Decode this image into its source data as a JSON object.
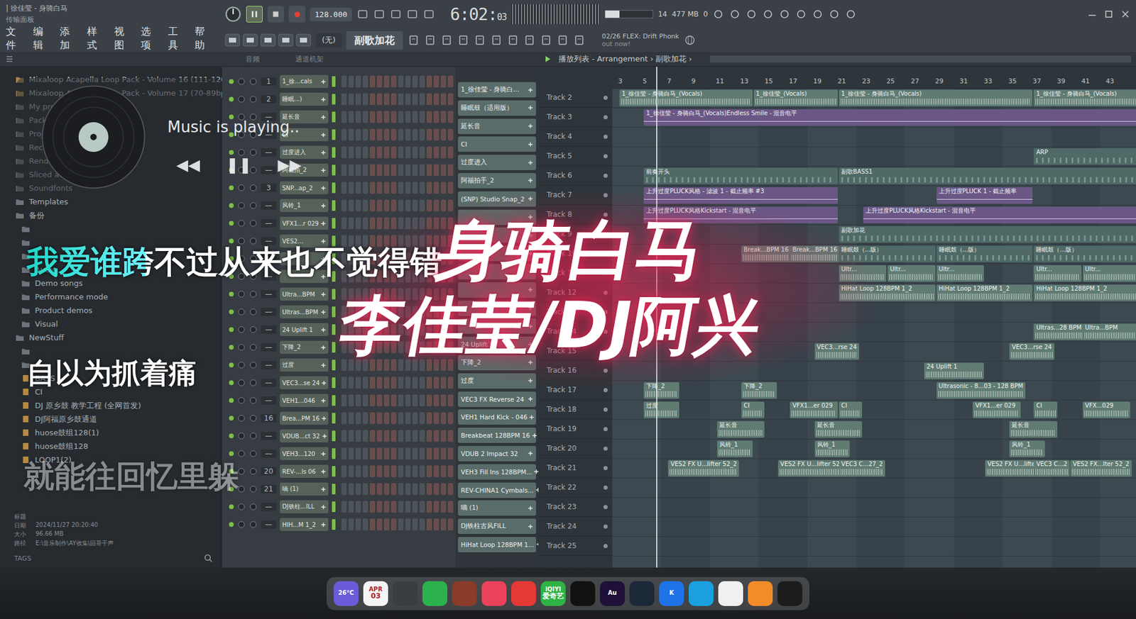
{
  "window": {
    "title": "| 徐佳莹 - 身骑白马",
    "subtitle": "传输面板"
  },
  "menu": [
    "文件",
    "编辑",
    "添加",
    "样式",
    "视图",
    "选项",
    "工具",
    "帮助"
  ],
  "transport": {
    "playing": true,
    "tempo": "128.000",
    "time": "6:02:",
    "time_frac": "03",
    "cpu": "14",
    "memory": "477 MB",
    "poly": "0",
    "snap": "(无)",
    "pattern": "副歌加花",
    "hint_title": "02/26 FLEX: Drift Phonk",
    "hint_body": "out now!"
  },
  "browser": {
    "items": [
      {
        "label": "Mixaloop Acapella Loop Pack - Volume 16 (111-120bpm)",
        "kind": "pack",
        "depth": 0
      },
      {
        "label": "Mixaloop Acapella Loop Pack - Volume 17 (70-89bpm)",
        "kind": "pack",
        "depth": 0
      },
      {
        "label": "My projects",
        "kind": "folder",
        "depth": 0
      },
      {
        "label": "Pack",
        "kind": "folder",
        "depth": 0
      },
      {
        "label": "Proj",
        "kind": "folder",
        "depth": 0
      },
      {
        "label": "Recor",
        "kind": "folder",
        "depth": 0
      },
      {
        "label": "Rendered",
        "kind": "folder",
        "depth": 0
      },
      {
        "label": "Sliced audio",
        "kind": "folder",
        "depth": 0
      },
      {
        "label": "Soundfonts",
        "kind": "folder",
        "depth": 0
      },
      {
        "label": "Templates",
        "kind": "folder",
        "depth": 0
      },
      {
        "label": "备份",
        "kind": "folder",
        "depth": 0
      },
      {
        "label": "",
        "kind": "folder",
        "depth": 1
      },
      {
        "label": "",
        "kind": "folder",
        "depth": 1
      },
      {
        "label": "",
        "kind": "folder",
        "depth": 1
      },
      {
        "label": "Audio",
        "kind": "folder",
        "depth": 1
      },
      {
        "label": "Demo songs",
        "kind": "folder",
        "depth": 1
      },
      {
        "label": "Performance mode",
        "kind": "folder",
        "depth": 1
      },
      {
        "label": "Product demos",
        "kind": "folder",
        "depth": 1
      },
      {
        "label": "Visual",
        "kind": "folder",
        "depth": 1
      },
      {
        "label": "NewStuff",
        "kind": "folder",
        "depth": 0
      },
      {
        "label": "",
        "kind": "folder",
        "depth": 1
      },
      {
        "label": "",
        "kind": "folder",
        "depth": 1
      },
      {
        "label": "BASS",
        "kind": "project",
        "depth": 1
      },
      {
        "label": "CI",
        "kind": "project",
        "depth": 1
      },
      {
        "label": "DJ 原乡鼓 教学工程 (全网首发)",
        "kind": "project",
        "depth": 1
      },
      {
        "label": "DJ阿福原乡鼓通道",
        "kind": "project",
        "depth": 1
      },
      {
        "label": "huose鼓组128(1)",
        "kind": "project",
        "depth": 1
      },
      {
        "label": "huose鼓组128",
        "kind": "project",
        "depth": 1
      },
      {
        "label": "LOOP1(2)",
        "kind": "project",
        "depth": 1
      }
    ],
    "file_info": [
      {
        "key": "标题",
        "value": ""
      },
      {
        "key": "日期",
        "value": "2024/11/27 20:20:40"
      },
      {
        "key": "大小",
        "value": "96.66 MB"
      },
      {
        "key": "路径",
        "value": "E:\\音乐制作\\AY收集\\回哥干声"
      }
    ],
    "tags": "TAGS"
  },
  "channel_rack": {
    "filter": "音频",
    "title": "通道机架",
    "rows": [
      {
        "num": "1",
        "name": "1_徐...cals"
      },
      {
        "num": "2",
        "name": "睡眠...)"
      },
      {
        "num": "—",
        "name": "延长音"
      },
      {
        "num": "—",
        "name": "CI"
      },
      {
        "num": "—",
        "name": "过度进入"
      },
      {
        "num": "—",
        "name": "阿福拍_2"
      },
      {
        "num": "3",
        "name": "SNP...ap_2"
      },
      {
        "num": "—",
        "name": "风铃_1"
      },
      {
        "num": "—",
        "name": "VFX1...r 029"
      },
      {
        "num": "—",
        "name": "VES2..."
      },
      {
        "num": "—",
        "name": ""
      },
      {
        "num": "—",
        "name": ""
      },
      {
        "num": "—",
        "name": "Ultra...BPM"
      },
      {
        "num": "—",
        "name": "Ultras...BPM"
      },
      {
        "num": "—",
        "name": "24 Uplift 1"
      },
      {
        "num": "—",
        "name": "下降_2"
      },
      {
        "num": "—",
        "name": "过度"
      },
      {
        "num": "—",
        "name": "VEC3...se 24"
      },
      {
        "num": "—",
        "name": "VEH1...046"
      },
      {
        "num": "16",
        "name": "Brea...PM 16"
      },
      {
        "num": "—",
        "name": "VDUB...ct 32"
      },
      {
        "num": "—",
        "name": "VEH3...120"
      },
      {
        "num": "20",
        "name": "REV-...ls 06"
      },
      {
        "num": "21",
        "name": "嘀 (1)"
      },
      {
        "num": "—",
        "name": "DJ铁柱...ILL"
      },
      {
        "num": "—",
        "name": "HIH...M 1_2"
      }
    ]
  },
  "patterns": [
    "1_徐佳莹 - 身骑白...",
    "睡眠鼓（适用版）",
    "延长音",
    "CI",
    "过度进入",
    "阿福拍手_2",
    "(SNP) Studio Snap_2",
    "",
    "",
    "",
    "",
    "",
    "",
    "",
    "24 Uplift 1",
    "下降_2",
    "过度",
    "VEC3 FX Reverse 24",
    "VEH1 Hard Kick - 046",
    "Breakbeat 128BPM 16",
    "VDUB 2 Impact 32",
    "VEH3 Fill Ins 128BPM...",
    "REV-CHINA1 Cymbals...",
    "嘀 (1)",
    "DJ铁柱古风FILL",
    "HiHat Loop 128BPM 1..."
  ],
  "playlist": {
    "breadcrumb": "播放列表 - Arrangement › 副歌加花 ›",
    "playhead": 6,
    "ruler": [
      "3",
      "5",
      "7",
      "9",
      "11",
      "13",
      "15",
      "17",
      "19",
      "21",
      "23",
      "25",
      "27",
      "29",
      "31",
      "33",
      "35",
      "37",
      "39",
      "41",
      "43"
    ],
    "tracks": [
      {
        "label": "Track 2",
        "clips": [
          {
            "label": "1_徐佳莹 - 身骑白马_(Vocals)",
            "bar": 3,
            "bars": 11,
            "kind": "audio"
          },
          {
            "label": "1_徐佳莹_(Vocals)",
            "bar": 14,
            "bars": 7,
            "kind": "audio"
          },
          {
            "label": "1_徐佳莹 - 身骑白马_(Vocals)",
            "bar": 21,
            "bars": 16,
            "kind": "audio"
          },
          {
            "label": "1_徐佳莹 - 身骑白马_(Vocals)",
            "bar": 37,
            "bars": 9,
            "kind": "audio"
          }
        ]
      },
      {
        "label": "Track 3",
        "clips": [
          {
            "label": "1_徐佳莹 - 身骑白马_(Vocals)Endless Smile - 混音电平",
            "bar": 5,
            "bars": 41,
            "kind": "automation"
          }
        ]
      },
      {
        "label": "Track 4",
        "clips": []
      },
      {
        "label": "Track 5",
        "clips": [
          {
            "label": "ARP",
            "bar": 37,
            "bars": 9,
            "kind": "pattern"
          }
        ]
      },
      {
        "label": "Track 6",
        "clips": [
          {
            "label": "前奏开头",
            "bar": 5,
            "bars": 16,
            "kind": "pattern"
          },
          {
            "label": "副歌BASS1",
            "bar": 21,
            "bars": 25,
            "kind": "pattern"
          }
        ]
      },
      {
        "label": "Track 7",
        "clips": [
          {
            "label": "上升过度PLUCK风格 - 滤波 1 - 截止频率 #3",
            "bar": 5,
            "bars": 16,
            "kind": "automation"
          },
          {
            "label": "上升过度PLUCK 1 - 截止频率",
            "bar": 29,
            "bars": 8,
            "kind": "automation"
          }
        ]
      },
      {
        "label": "Track 8",
        "clips": [
          {
            "label": "上升过度PLUCK风格Kickstart - 混音电平",
            "bar": 5,
            "bars": 16,
            "kind": "automation"
          },
          {
            "label": "上升过度PLUCK风格Kickstart - 混音电平",
            "bar": 23,
            "bars": 23,
            "kind": "automation"
          }
        ]
      },
      {
        "label": "Track 9",
        "clips": [
          {
            "label": "副歌加花",
            "bar": 21,
            "bars": 25,
            "kind": "pattern"
          }
        ]
      },
      {
        "label": "Track 10",
        "clips": [
          {
            "label": "Break...BPM 16",
            "bar": 13,
            "bars": 4,
            "kind": "audio"
          },
          {
            "label": "Break...BPM 16",
            "bar": 17,
            "bars": 4,
            "kind": "audio"
          },
          {
            "label": "睡眠鼓（...版）",
            "bar": 21,
            "bars": 8,
            "kind": "pattern"
          },
          {
            "label": "睡眠鼓（...版）",
            "bar": 29,
            "bars": 8,
            "kind": "pattern"
          },
          {
            "label": "睡眠鼓（...版）",
            "bar": 37,
            "bars": 9,
            "kind": "pattern"
          }
        ]
      },
      {
        "label": "Track 11",
        "clips": [
          {
            "label": "Ultr...",
            "bar": 21,
            "bars": 4,
            "kind": "audio"
          },
          {
            "label": "Ultr...",
            "bar": 25,
            "bars": 4,
            "kind": "audio"
          },
          {
            "label": "Ultr...",
            "bar": 29,
            "bars": 4,
            "kind": "audio"
          },
          {
            "label": "Ultr...",
            "bar": 37,
            "bars": 4,
            "kind": "audio"
          },
          {
            "label": "Ultr...",
            "bar": 41,
            "bars": 5,
            "kind": "audio"
          }
        ]
      },
      {
        "label": "Track 12",
        "clips": [
          {
            "label": "HiHat Loop 128BPM 1_2",
            "bar": 21,
            "bars": 8,
            "kind": "audio"
          },
          {
            "label": "HiHat Loop 128BPM 1_2",
            "bar": 29,
            "bars": 8,
            "kind": "audio"
          },
          {
            "label": "HiHat Loop 128BPM 1_2",
            "bar": 37,
            "bars": 9,
            "kind": "audio"
          }
        ]
      },
      {
        "label": "Track 13",
        "clips": []
      },
      {
        "label": "Track 14",
        "clips": [
          {
            "label": "Ultras...28 BPM",
            "bar": 37,
            "bars": 4,
            "kind": "audio"
          },
          {
            "label": "Ultra...BPM",
            "bar": 41,
            "bars": 5,
            "kind": "audio"
          }
        ]
      },
      {
        "label": "Track 15",
        "clips": [
          {
            "label": "VEC3...rse 24",
            "bar": 19,
            "bars": 3,
            "kind": "audio"
          },
          {
            "label": "VEC3...rse 24",
            "bar": 35,
            "bars": 3,
            "kind": "audio"
          }
        ]
      },
      {
        "label": "Track 16",
        "clips": [
          {
            "label": "24 Uplift 1",
            "bar": 28,
            "bars": 5,
            "kind": "audio"
          }
        ]
      },
      {
        "label": "Track 17",
        "clips": [
          {
            "label": "下降_2",
            "bar": 5,
            "bars": 3,
            "kind": "audio"
          },
          {
            "label": "下降_2",
            "bar": 13,
            "bars": 3,
            "kind": "audio"
          },
          {
            "label": "Ultrasonic - 8...03 - 128 BPM",
            "bar": 29,
            "bars": 7,
            "kind": "audio"
          }
        ]
      },
      {
        "label": "Track 18",
        "clips": [
          {
            "label": "过度",
            "bar": 5,
            "bars": 3,
            "kind": "audio"
          },
          {
            "label": "CI",
            "bar": 13,
            "bars": 2,
            "kind": "audio"
          },
          {
            "label": "VFX1...er 029",
            "bar": 17,
            "bars": 4,
            "kind": "audio"
          },
          {
            "label": "CI",
            "bar": 21,
            "bars": 2,
            "kind": "audio"
          },
          {
            "label": "VFX1...er 029",
            "bar": 32,
            "bars": 4,
            "kind": "audio"
          },
          {
            "label": "CI",
            "bar": 37,
            "bars": 2,
            "kind": "audio"
          },
          {
            "label": "VFX...029",
            "bar": 41,
            "bars": 4,
            "kind": "audio"
          }
        ]
      },
      {
        "label": "Track 19",
        "clips": [
          {
            "label": "延长音",
            "bar": 11,
            "bars": 4,
            "kind": "audio"
          },
          {
            "label": "延长音",
            "bar": 19,
            "bars": 4,
            "kind": "audio"
          },
          {
            "label": "延长音",
            "bar": 35,
            "bars": 4,
            "kind": "audio"
          }
        ]
      },
      {
        "label": "Track 20",
        "clips": [
          {
            "label": "风铃_1",
            "bar": 11,
            "bars": 3,
            "kind": "audio"
          },
          {
            "label": "风铃_1",
            "bar": 19,
            "bars": 3,
            "kind": "audio"
          },
          {
            "label": "风铃_1",
            "bar": 35,
            "bars": 3,
            "kind": "audio"
          }
        ]
      },
      {
        "label": "Track 21",
        "clips": [
          {
            "label": "VES2 FX U...lifter 52_2",
            "bar": 7,
            "bars": 5,
            "kind": "audio"
          },
          {
            "label": "VES2 FX U...lifter 52_2",
            "bar": 16,
            "bars": 5,
            "kind": "audio"
          },
          {
            "label": "VEC3 C...27_2",
            "bar": 21,
            "bars": 3,
            "kind": "audio"
          },
          {
            "label": "VES2 FX U...lifter 52_2",
            "bar": 33,
            "bars": 4,
            "kind": "audio"
          },
          {
            "label": "VEC3 C...2",
            "bar": 37,
            "bars": 2,
            "kind": "audio"
          },
          {
            "label": "VES2 FX...lter 52_2",
            "bar": 40,
            "bars": 5,
            "kind": "audio"
          }
        ]
      },
      {
        "label": "Track 22",
        "clips": []
      },
      {
        "label": "Track 23",
        "clips": []
      },
      {
        "label": "Track 24",
        "clips": []
      },
      {
        "label": "Track 25",
        "clips": []
      }
    ]
  },
  "player": {
    "status": "Music is playing..",
    "prev": "◀◀",
    "pause": "❚❚",
    "next": "▶▶"
  },
  "lyrics": [
    {
      "text": "我爱谁跨不过从来也不觉得错",
      "level": 0.286,
      "kind": "current"
    },
    {
      "text": "自以为抓着痛",
      "level": 0,
      "kind": "next"
    },
    {
      "text": "就能往回忆里躲",
      "level": 0,
      "kind": "fading"
    }
  ],
  "title_card": {
    "song": "身骑白马",
    "artist": "李佳莹/DJ阿兴"
  },
  "dock": [
    {
      "label": "26°C",
      "sub": "",
      "color": "#6a5cd8"
    },
    {
      "label": "APR",
      "sub": "03",
      "color": "#f4f4f4"
    },
    {
      "label": "",
      "sub": "",
      "color": "#3a3d42"
    },
    {
      "label": "",
      "sub": "",
      "color": "#2bb24c"
    },
    {
      "label": "",
      "sub": "",
      "color": "#8a3b2a"
    },
    {
      "label": "",
      "sub": "",
      "color": "#e9425a"
    },
    {
      "label": "",
      "sub": "",
      "color": "#e53935"
    },
    {
      "label": "iQIYI",
      "sub": "爱奇艺",
      "color": "#2fb344"
    },
    {
      "label": "",
      "sub": "",
      "color": "#111111"
    },
    {
      "label": "Au",
      "sub": "",
      "color": "#1e1038"
    },
    {
      "label": "",
      "sub": "",
      "color": "#1b2838"
    },
    {
      "label": "K",
      "sub": "",
      "color": "#1e73e8"
    },
    {
      "label": "",
      "sub": "",
      "color": "#1aa0e0"
    },
    {
      "label": "",
      "sub": "",
      "color": "#f0f0f0"
    },
    {
      "label": "",
      "sub": "",
      "color": "#f28c28"
    },
    {
      "label": "",
      "sub": "",
      "color": "#1c1c1c"
    }
  ]
}
